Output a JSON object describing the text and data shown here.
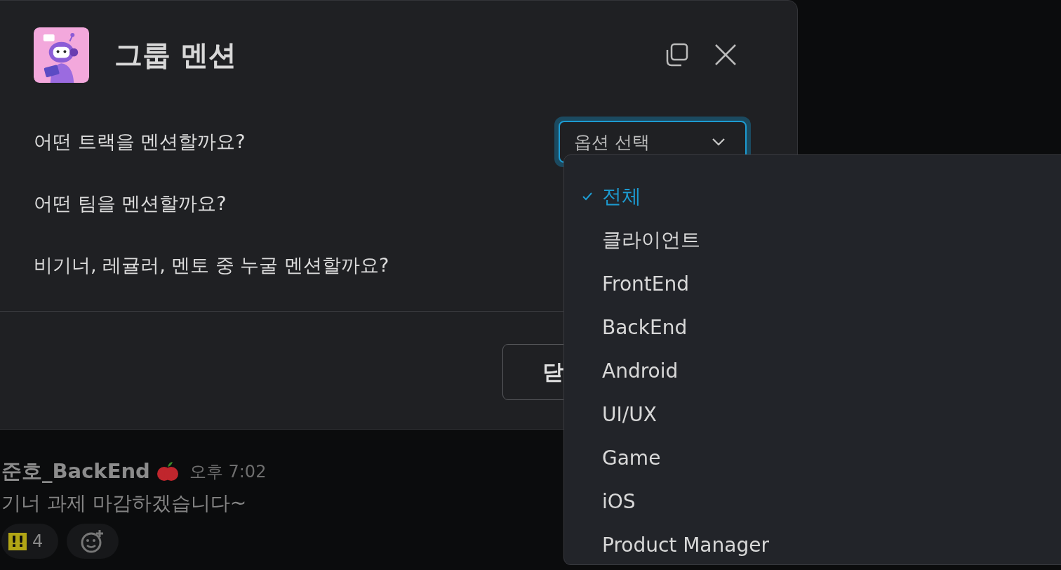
{
  "modal": {
    "title": "그룹 멘션",
    "questions": [
      {
        "label": "어떤 트랙을 멘션할까요?",
        "select": {
          "placeholder": "옵션 선택",
          "expanded": true
        }
      },
      {
        "label": "어떤 팀을 멘션할까요?"
      },
      {
        "label": "비기너, 레귤러, 멘토 중 누굴 멘션할까요?"
      }
    ],
    "footer_button": "닫",
    "dropdown": {
      "options": [
        {
          "label": "전체",
          "selected": true
        },
        {
          "label": "클라이언트",
          "selected": false
        },
        {
          "label": "FrontEnd",
          "selected": false
        },
        {
          "label": "BackEnd",
          "selected": false
        },
        {
          "label": "Android",
          "selected": false
        },
        {
          "label": "UI/UX",
          "selected": false
        },
        {
          "label": "Game",
          "selected": false
        },
        {
          "label": "iOS",
          "selected": false
        },
        {
          "label": "Product Manager",
          "selected": false
        }
      ]
    }
  },
  "message": {
    "author": "준호_BackEnd",
    "time": "오후 7:02",
    "text": "기너 과제 마감하겠습니다~",
    "reactions": [
      {
        "emoji": "!!",
        "count": "4"
      }
    ]
  }
}
